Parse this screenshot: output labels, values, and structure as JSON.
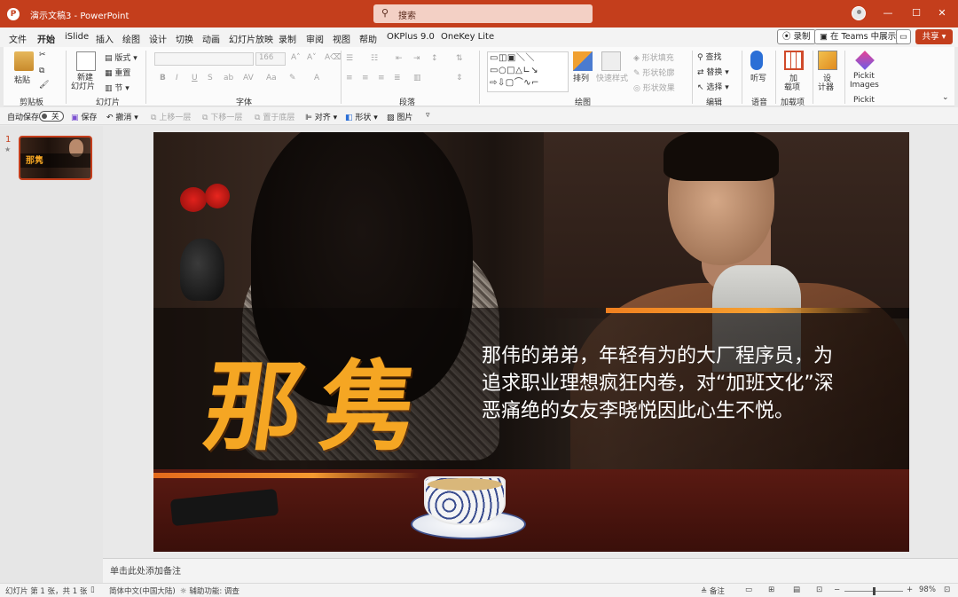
{
  "titlebar": {
    "doc_name": "演示文稿3",
    "separator": " - ",
    "app_name": "PowerPoint",
    "search_placeholder": "搜索"
  },
  "tabs": [
    "文件",
    "开始",
    "iSlide",
    "插入",
    "绘图",
    "设计",
    "切换",
    "动画",
    "幻灯片放映",
    "录制",
    "审阅",
    "视图",
    "帮助",
    "OKPlus 9.0",
    "OneKey Lite"
  ],
  "active_tab": "开始",
  "tab_actions": {
    "record": "录制",
    "teams": "在 Teams 中展示",
    "share": "共享"
  },
  "ribbon": {
    "clipboard": {
      "paste": "粘贴",
      "label": "剪贴板"
    },
    "slides": {
      "new_slide": "新建",
      "new_slide2": "幻灯片",
      "layout": "版式",
      "reset": "重置",
      "section": "节",
      "label": "幻灯片"
    },
    "font": {
      "size": "166",
      "label": "字体"
    },
    "paragraph": {
      "label": "段落"
    },
    "drawing": {
      "arrange": "排列",
      "quick_styles": "快速样式",
      "shape_fill": "形状填充",
      "shape_outline": "形状轮廓",
      "shape_effects": "形状效果",
      "label": "绘图"
    },
    "editing": {
      "find": "查找",
      "replace": "替换",
      "select": "选择",
      "label": "编辑"
    },
    "voice": {
      "dictate": "听写",
      "label": "语音"
    },
    "addins": {
      "addin1": "加",
      "addin2": "载项",
      "label": "加载项"
    },
    "designer": {
      "designer1": "设",
      "designer2": "计器"
    },
    "pickit": {
      "name1": "Pickit",
      "name2": "Images",
      "label": "Pickit"
    }
  },
  "qat": {
    "autosave": "自动保存",
    "autosave_state": "关",
    "save": "保存",
    "undo": "撤消",
    "bring_forward": "上移一层",
    "send_backward": "下移一层",
    "send_to_back": "置于底层",
    "align": "对齐",
    "shapes": "形状",
    "picture": "图片"
  },
  "slides_panel": {
    "slide_number": "1",
    "thumb_title": "那隽"
  },
  "slide": {
    "title": "那隽",
    "description": "那伟的弟弟，年轻有为的大厂程序员，为追求职业理想疯狂内卷，对“加班文化”深恶痛绝的女友李晓悦因此心生不悦。"
  },
  "notes_placeholder": "单击此处添加备注",
  "status": {
    "slide_info": "幻灯片 第 1 张，共 1 张",
    "language": "简体中文(中国大陆)",
    "accessibility": "辅助功能: 调查",
    "notes": "备注",
    "zoom": "98%"
  },
  "colors": {
    "accent": "#c43e1c",
    "title_orange": "#f5a623"
  }
}
